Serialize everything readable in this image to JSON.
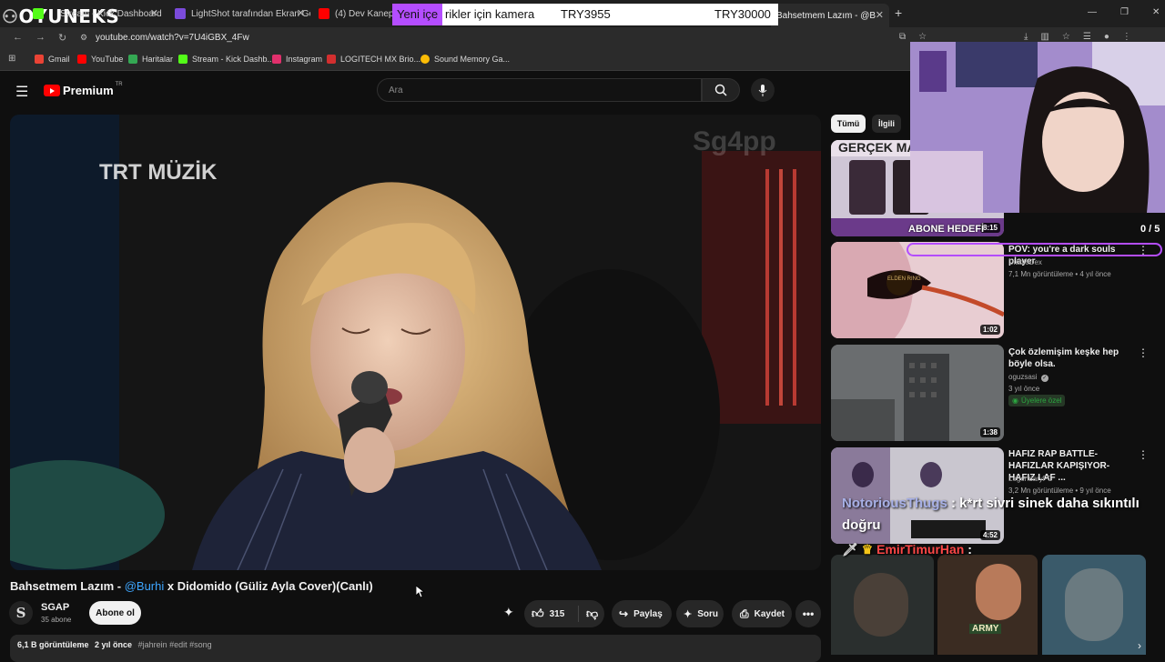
{
  "streamer_logo": "OYUNEKS",
  "browser": {
    "tabs": [
      {
        "title": "Stream - Kick Dashboard",
        "color": "#53fc18"
      },
      {
        "title": "LightShot tarafından Ekran Gör",
        "color": "#7b4bdb"
      },
      {
        "title": "(4) Dev Kanepe Be",
        "color": "#ff0000"
      },
      {
        "title": "Bahsetmem Lazım - @B",
        "color": "#ff0000"
      }
    ],
    "new_tab": "+",
    "url": "youtube.com/watch?v=7U4iGBX_4Fw",
    "bookmarks": [
      {
        "label": "Gmail",
        "color": "#ea4335"
      },
      {
        "label": "YouTube",
        "color": "#ff0000"
      },
      {
        "label": "Haritalar",
        "color": "#34a853"
      },
      {
        "label": "Stream - Kick Dashb...",
        "color": "#53fc18"
      },
      {
        "label": "Instagram",
        "color": "#e1306c"
      },
      {
        "label": "LOGITECH MX Brio...",
        "color": "#d32f2f"
      },
      {
        "label": "Sound Memory Ga...",
        "color": "#fbbc05"
      }
    ]
  },
  "overlay_banner": {
    "text_a": "Yeni içe",
    "text_b": "rikler için kamera",
    "price1": "TRY3955",
    "price2": "TRY30000"
  },
  "youtube": {
    "brand": "Premium",
    "region": "TR",
    "search_placeholder": "Ara",
    "video": {
      "watermark_channel": "TRT MÜZİK",
      "watermark_tag": "Sg4pp",
      "title_prefix": "Bahsetmem Lazım - ",
      "title_mention": "@Burhi",
      "title_suffix": " x Didomido (Güliz Ayla Cover)(Canlı)",
      "channel": "SGAP",
      "subscribers": "35 abone",
      "subscribe": "Abone ol",
      "likes": "315",
      "share": "Paylaş",
      "ask": "Soru",
      "save": "Kaydet",
      "views": "6,1 B görüntüleme",
      "age": "2 yıl önce",
      "tags": "#jahrein #edit #song"
    },
    "filters": [
      "Tümü",
      "İlgili"
    ],
    "suggestions": [
      {
        "title": "GERÇEK MANIFEST",
        "duration": "8:15",
        "channel": "",
        "meta": ""
      },
      {
        "title": "POV: you're a dark souls player",
        "duration": "1:02",
        "channel": "DiabloDex",
        "meta": "7,1 Mn görüntüleme • 4 yıl önce"
      },
      {
        "title": "Çok özlemişim keşke hep böyle olsa.",
        "duration": "1:38",
        "channel": "oguzsasi",
        "meta": "3 yıl önce",
        "badge": "Üyelere özel"
      },
      {
        "title": "HAFIZ RAP BATTLE-HAFIZLAR KAPIŞIYOR-HAFIZ LAF ...",
        "duration": "4:52",
        "channel": "LegendaryFC",
        "meta": "3,2 Mn görüntüleme • 9 yıl önce"
      }
    ]
  },
  "stream_overlay": {
    "sub_goal_label": "ABONE HEDEFİ",
    "sub_goal_value": "0 / 5",
    "chat": [
      {
        "user": "NotoriousThugs",
        "message": "k*rt sivri sinek daha sıkıntılı doğru"
      },
      {
        "user": "EmirTimurHan",
        "message": ""
      }
    ],
    "army_label": "ARMY",
    "thumb_texts": [
      "ELDEN RING"
    ]
  },
  "colors": {
    "accent_red": "#ff0000",
    "kick_green": "#53fc18",
    "overlay_purple": "#b44dff",
    "mention_blue": "#3ea6ff"
  }
}
